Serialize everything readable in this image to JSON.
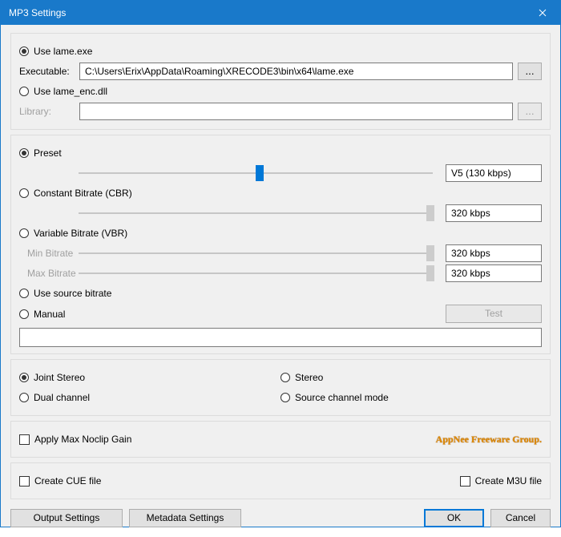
{
  "window": {
    "title": "MP3 Settings"
  },
  "encoder": {
    "use_lame_exe": {
      "label": "Use lame.exe",
      "checked": true
    },
    "executable_label": "Executable:",
    "executable_value": "C:\\Users\\Erix\\AppData\\Roaming\\XRECODE3\\bin\\x64\\lame.exe",
    "browse": "...",
    "use_lame_dll": {
      "label": "Use lame_enc.dll",
      "checked": false
    },
    "library_label": "Library:",
    "library_value": "",
    "library_browse": "..."
  },
  "bitrate": {
    "preset": {
      "label": "Preset",
      "checked": true,
      "value": "V5 (130 kbps)",
      "pos_pct": 50
    },
    "cbr": {
      "label": "Constant Bitrate (CBR)",
      "checked": false,
      "value": "320 kbps",
      "pos_pct": 97
    },
    "vbr": {
      "label": "Variable Bitrate (VBR)",
      "checked": false
    },
    "vbr_min": {
      "label": "Min Bitrate",
      "value": "320 kbps",
      "pos_pct": 97
    },
    "vbr_max": {
      "label": "Max Bitrate",
      "value": "320 kbps",
      "pos_pct": 97
    },
    "use_source": {
      "label": "Use source bitrate",
      "checked": false
    },
    "manual": {
      "label": "Manual",
      "checked": false
    },
    "test_label": "Test",
    "manual_value": ""
  },
  "channels": {
    "joint_stereo": {
      "label": "Joint Stereo",
      "checked": true
    },
    "stereo": {
      "label": "Stereo",
      "checked": false
    },
    "dual_channel": {
      "label": "Dual channel",
      "checked": false
    },
    "source_mode": {
      "label": "Source channel mode",
      "checked": false
    }
  },
  "gain": {
    "apply_noclip": {
      "label": "Apply Max Noclip Gain",
      "checked": false
    },
    "watermark": "AppNee Freeware Group."
  },
  "files": {
    "create_cue": {
      "label": "Create CUE file",
      "checked": false
    },
    "create_m3u": {
      "label": "Create M3U file",
      "checked": false
    }
  },
  "buttons": {
    "output_settings": "Output Settings",
    "metadata_settings": "Metadata Settings",
    "ok": "OK",
    "cancel": "Cancel"
  }
}
